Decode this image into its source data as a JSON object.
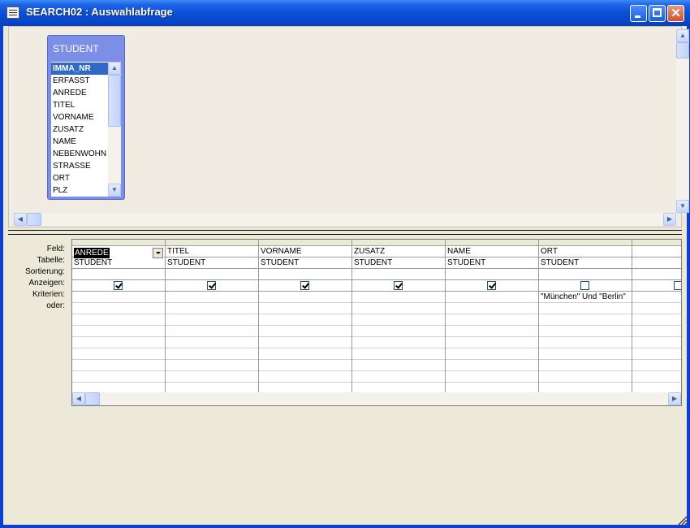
{
  "window": {
    "title": "SEARCH02 : Auswahlabfrage"
  },
  "field_list": {
    "title": "STUDENT",
    "fields": [
      "IMMA_NR",
      "ERFASST",
      "ANREDE",
      "TITEL",
      "VORNAME",
      "ZUSATZ",
      "NAME",
      "NEBENWOHN",
      "STRASSE",
      "ORT",
      "PLZ"
    ],
    "selected": "IMMA_NR"
  },
  "grid": {
    "row_labels": {
      "feld": "Feld:",
      "tabelle": "Tabelle:",
      "sortierung": "Sortierung:",
      "anzeigen": "Anzeigen:",
      "kriterien": "Kriterien:",
      "oder": "oder:"
    },
    "columns": [
      {
        "feld": "ANREDE",
        "tabelle": "STUDENT",
        "anzeigen": true,
        "kriterien": ""
      },
      {
        "feld": "TITEL",
        "tabelle": "STUDENT",
        "anzeigen": true,
        "kriterien": ""
      },
      {
        "feld": "VORNAME",
        "tabelle": "STUDENT",
        "anzeigen": true,
        "kriterien": ""
      },
      {
        "feld": "ZUSATZ",
        "tabelle": "STUDENT",
        "anzeigen": true,
        "kriterien": ""
      },
      {
        "feld": "NAME",
        "tabelle": "STUDENT",
        "anzeigen": true,
        "kriterien": ""
      },
      {
        "feld": "ORT",
        "tabelle": "STUDENT",
        "anzeigen": false,
        "kriterien": "\"München\" Und \"Berlin\""
      },
      {
        "feld": "",
        "tabelle": "",
        "anzeigen": false,
        "kriterien": ""
      }
    ]
  }
}
